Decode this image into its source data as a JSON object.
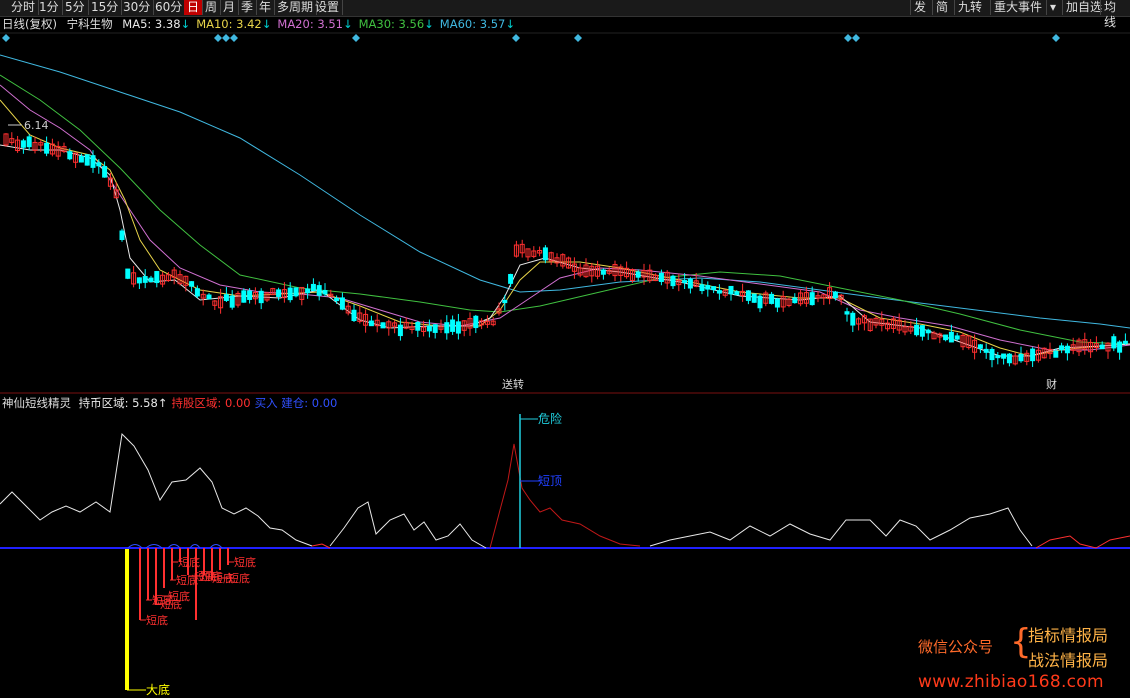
{
  "toolbar": {
    "left_tabs": [
      {
        "label": "分时",
        "active": false
      },
      {
        "label": "1分",
        "active": false
      },
      {
        "label": "5分",
        "active": false
      },
      {
        "label": "15分",
        "active": false
      },
      {
        "label": "30分",
        "active": false
      },
      {
        "label": "60分",
        "active": false
      },
      {
        "label": "日",
        "active": true
      },
      {
        "label": "周",
        "active": false
      },
      {
        "label": "月",
        "active": false
      },
      {
        "label": "季",
        "active": false
      },
      {
        "label": "年",
        "active": false
      },
      {
        "label": "多周期",
        "active": false
      },
      {
        "label": "设置",
        "active": false
      }
    ],
    "right_tabs": [
      {
        "label": "发"
      },
      {
        "label": "简"
      },
      {
        "label": "九转"
      },
      {
        "label": "重大事件"
      },
      {
        "label": "▾"
      },
      {
        "label": "加自选"
      },
      {
        "label": "均线"
      }
    ]
  },
  "price_panel": {
    "period": "日线(复权)",
    "stock_name": "宁科生物",
    "ma": [
      {
        "label": "MA5: 3.38",
        "arrow": "↓",
        "color": "#e8e8e8"
      },
      {
        "label": "MA10: 3.42",
        "arrow": "↓",
        "color": "#e8d44a"
      },
      {
        "label": "MA20: 3.51",
        "arrow": "↓",
        "color": "#d070d0"
      },
      {
        "label": "MA30: 3.56",
        "arrow": "↓",
        "color": "#40c040"
      },
      {
        "label": "MA60: 3.57",
        "arrow": "↓",
        "color": "#40b8e0"
      }
    ],
    "high_mark": "6.14",
    "event_marks": [
      "送转",
      "财"
    ]
  },
  "indicator_panel": {
    "name": "神仙短线精灵",
    "fields": [
      {
        "label": "持币区域: 5.58",
        "arrow": "↑",
        "color": "#e8e8e8"
      },
      {
        "label": "持股区域: 0.00",
        "arrow": "",
        "color": "#ff3030"
      },
      {
        "label": "买入 建仓: 0.00",
        "arrow": "",
        "color": "#3050ff"
      }
    ],
    "signals": {
      "danger": "危险",
      "short_top": "短顶",
      "short_bottom": "短底",
      "big_bottom": "大底"
    }
  },
  "colors": {
    "up": "#ff3030",
    "down": "#00ffff",
    "background": "#000000",
    "baseline": "#2020ff"
  },
  "watermark": {
    "wechat": "微信公众号",
    "name1": "指标情报局",
    "name2": "战法情报局",
    "url": "www.zhibiao168.com"
  }
}
